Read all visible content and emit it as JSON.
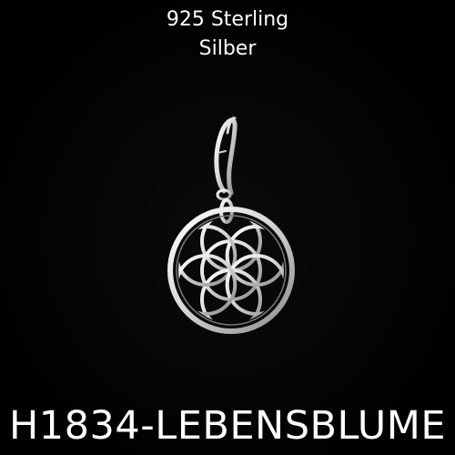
{
  "header": {
    "line1": "925 Sterling",
    "line2": "Silber"
  },
  "product": {
    "code": "H1834-LEBENSBLUME"
  },
  "image": {
    "subject_icon": "flower-of-life-charm-icon",
    "background_color": "#000000",
    "text_color": "#ffffff",
    "metal_color": "#e6e6e6"
  }
}
